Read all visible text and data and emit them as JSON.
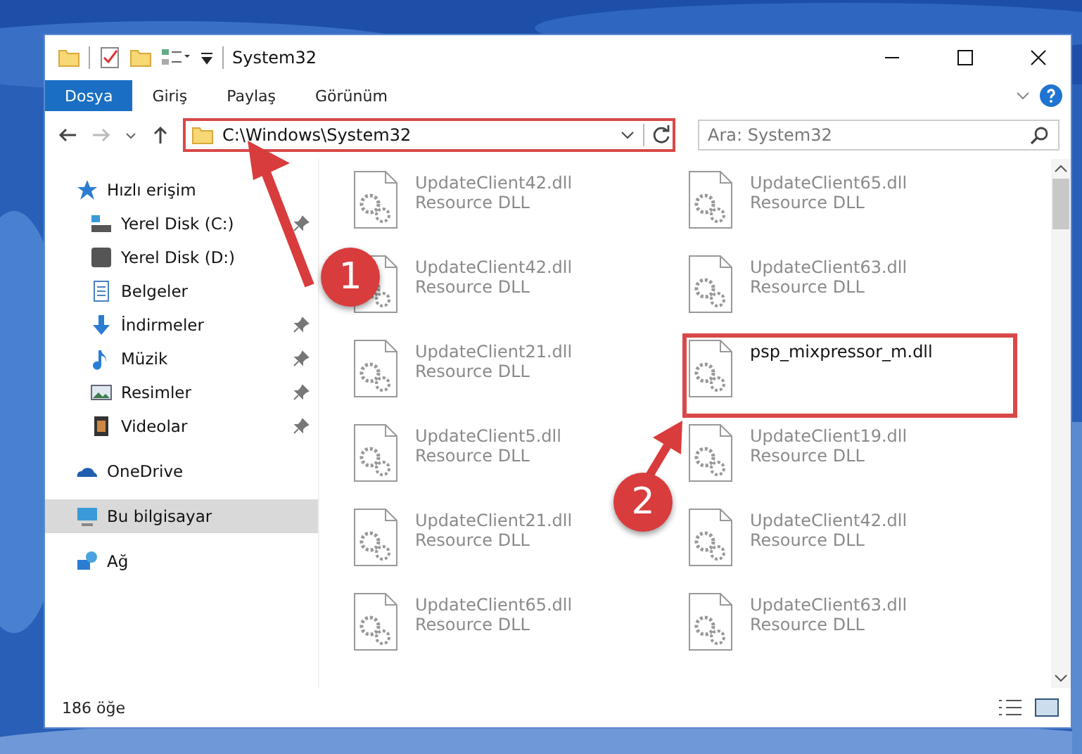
{
  "window": {
    "title": "System32"
  },
  "ribbon_tabs": [
    {
      "label": "Dosya",
      "selected": true
    },
    {
      "label": "Giriş",
      "selected": false
    },
    {
      "label": "Paylaş",
      "selected": false
    },
    {
      "label": "Görünüm",
      "selected": false
    }
  ],
  "address": {
    "path": "C:\\Windows\\System32",
    "highlighted": true
  },
  "search": {
    "placeholder": "Ara: System32"
  },
  "sidebar": {
    "items": [
      {
        "label": "Hızlı erişim",
        "kind": "star",
        "pinned": false,
        "selected": false,
        "children": [
          {
            "label": "Yerel Disk (C:)",
            "kind": "sysdrive",
            "pinned": true,
            "selected": false
          },
          {
            "label": "Yerel Disk (D:)",
            "kind": "drive",
            "pinned": false,
            "selected": false
          },
          {
            "label": "Belgeler",
            "kind": "doc",
            "pinned": false,
            "selected": false
          },
          {
            "label": "İndirmeler",
            "kind": "download",
            "pinned": true,
            "selected": false
          },
          {
            "label": "Müzik",
            "kind": "music",
            "pinned": true,
            "selected": false
          },
          {
            "label": "Resimler",
            "kind": "pictures",
            "pinned": true,
            "selected": false
          },
          {
            "label": "Videolar",
            "kind": "video",
            "pinned": true,
            "selected": false
          }
        ]
      },
      {
        "label": "OneDrive",
        "kind": "cloud",
        "pinned": false,
        "selected": false
      },
      {
        "label": "Bu bilgisayar",
        "kind": "pc",
        "pinned": false,
        "selected": true
      },
      {
        "label": "Ağ",
        "kind": "network",
        "pinned": false,
        "selected": false
      }
    ]
  },
  "files": [
    {
      "name": "UpdateClient42.dll",
      "type": "Resource DLL",
      "faded": true,
      "highlighted": false
    },
    {
      "name": "UpdateClient65.dll",
      "type": "Resource DLL",
      "faded": true,
      "highlighted": false
    },
    {
      "name": "UpdateClient42.dll",
      "type": "Resource DLL",
      "faded": true,
      "highlighted": false
    },
    {
      "name": "UpdateClient63.dll",
      "type": "Resource DLL",
      "faded": true,
      "highlighted": false
    },
    {
      "name": "UpdateClient21.dll",
      "type": "Resource DLL",
      "faded": true,
      "highlighted": false
    },
    {
      "name": "psp_mixpressor_m.dll",
      "faded": false,
      "highlighted": true
    },
    {
      "name": "UpdateClient5.dll",
      "type": "Resource DLL",
      "faded": true,
      "highlighted": false
    },
    {
      "name": "UpdateClient19.dll",
      "type": "Resource DLL",
      "faded": true,
      "highlighted": false
    },
    {
      "name": "UpdateClient21.dll",
      "type": "Resource DLL",
      "faded": true,
      "highlighted": false
    },
    {
      "name": "UpdateClient42.dll",
      "type": "Resource DLL",
      "faded": true,
      "highlighted": false
    },
    {
      "name": "UpdateClient65.dll",
      "type": "Resource DLL",
      "faded": true,
      "highlighted": false
    },
    {
      "name": "UpdateClient63.dll",
      "type": "Resource DLL",
      "faded": true,
      "highlighted": false
    }
  ],
  "status_bar": {
    "count": "186 öğe"
  },
  "annotations": [
    {
      "number": "1"
    },
    {
      "number": "2"
    }
  ]
}
